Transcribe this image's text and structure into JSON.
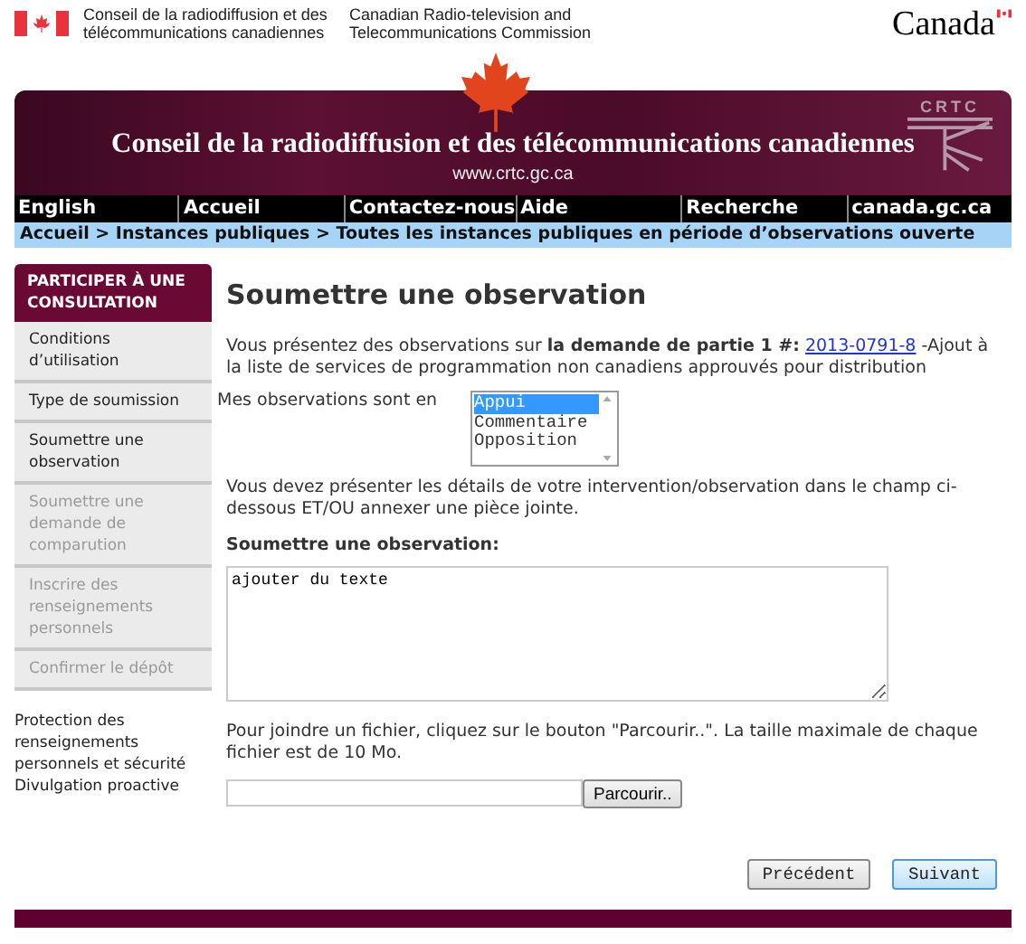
{
  "header": {
    "name_fr": "Conseil de la radiodiffusion et des télécommunications canadiennes",
    "name_en": "Canadian Radio-television and Telecommunications Commission",
    "wordmark": "Canada"
  },
  "banner": {
    "title": "Conseil de la radiodiffusion et des télécommunications canadiennes",
    "url": "www.crtc.gc.ca",
    "logo_text": "CRTC"
  },
  "nav": [
    "English",
    "Accueil",
    "Contactez-nous",
    "Aide",
    "Recherche",
    "canada.gc.ca"
  ],
  "breadcrumb": "Accueil > Instances publiques > Toutes les instances publiques en période d’observations ouverte",
  "sidebar": {
    "title": "PARTICIPER À UNE CONSULTATION",
    "items": [
      {
        "label": "Conditions d’utilisation",
        "disabled": false
      },
      {
        "label": "Type de soumission",
        "disabled": false
      },
      {
        "label": "Soumettre une observation",
        "disabled": false
      },
      {
        "label": "Soumettre une demande de comparution",
        "disabled": true
      },
      {
        "label": "Inscrire des renseignements personnels",
        "disabled": true
      },
      {
        "label": "Confirmer le dépôt",
        "disabled": true
      }
    ],
    "links": [
      "Protection des renseignements personnels et sécurité",
      "Divulgation proactive"
    ]
  },
  "page_title": "Soumettre une observation",
  "intro": {
    "before": "Vous présentez des observations sur **la demande de partie 1 #:**",
    "link": "2013-0791-8",
    "after": "-Ajout à la liste de services de programmation non canadiens approuvés pour distribution"
  },
  "position": {
    "label": "Mes observations sont en",
    "options": [
      {
        "label": "Appui",
        "selected": true
      },
      {
        "label": "Commentaire",
        "selected": false
      },
      {
        "label": "Opposition",
        "selected": false
      }
    ]
  },
  "instructions": "Vous devez présenter les détails de votre intervention/observation dans le champ ci-dessous ET/OU annexer une pièce jointe.",
  "observation": {
    "label": "Soumettre une observation:",
    "value": "ajouter du texte"
  },
  "attach_note": "Pour joindre un fichier, cliquez sur le bouton \"Parcourir..\". La taille maximale de chaque fichier est de 10 Mo.",
  "browse_button": "Parcourir..",
  "buttons": [
    "Précédent",
    "Suivant"
  ]
}
